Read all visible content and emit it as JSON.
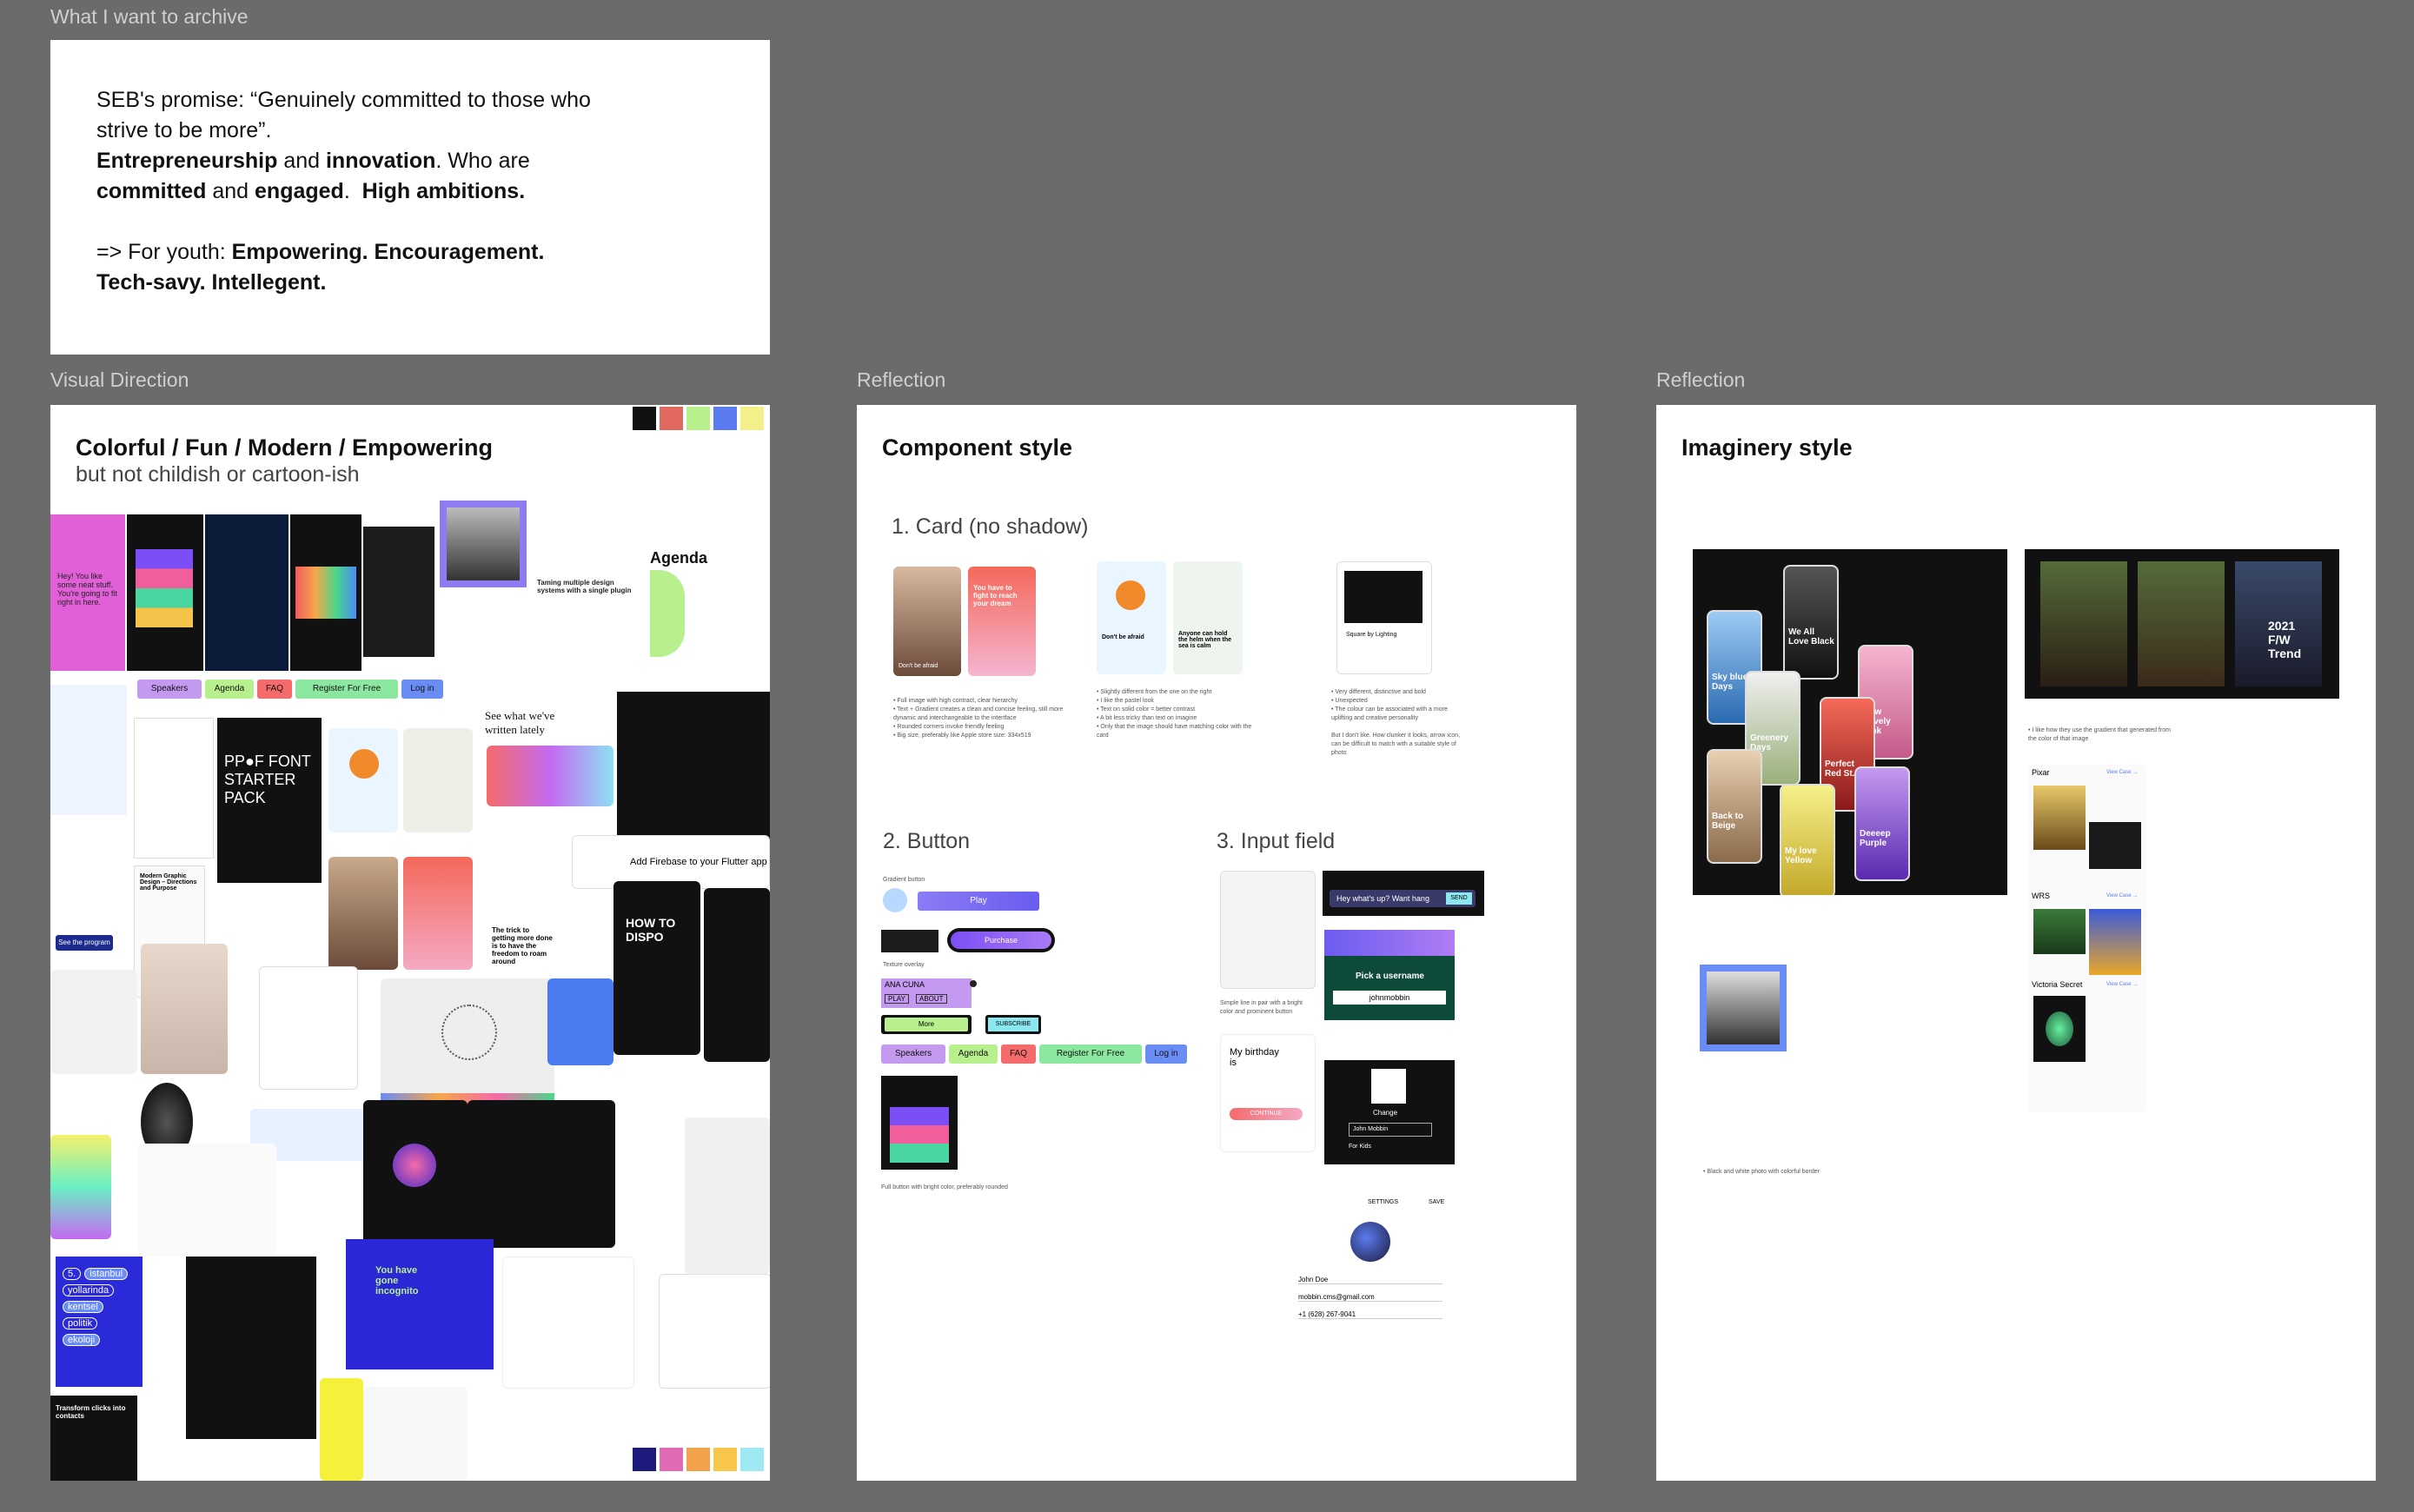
{
  "labels": {
    "archive": "What I want to archive",
    "visual": "Visual Direction",
    "reflection1": "Reflection",
    "reflection2": "Reflection"
  },
  "archive": {
    "line1": "SEB's promise: “Genuinely committed to those who",
    "line2": "strive to be more”.",
    "l3_b1": "Entrepreneurship",
    "l3_t1": " and ",
    "l3_b2": "innovation",
    "l3_t2": ". Who are",
    "l4_b1": "committed",
    "l4_t1": " and ",
    "l4_b2": "engaged",
    "l4_t2": ".  ",
    "l4_b3": "High ambitions.",
    "l5_t1": "=> For youth: ",
    "l5_b1": "Empowering. Encouragement.",
    "l6_b1": "Tech-savy. Intellegent."
  },
  "visual": {
    "title": "Colorful / Fun / Modern / Empowering",
    "subtitle": "but not childish or cartoon-ish",
    "palette_top": [
      "#111111",
      "#e0685f",
      "#b7f08c",
      "#5b7cf0",
      "#f3f08a"
    ],
    "palette_bottom": [
      "#1c1a7a",
      "#e06ab3",
      "#f2a24b",
      "#f7c64a",
      "#9fe9f2"
    ],
    "pills": [
      "Speakers",
      "Agenda",
      "FAQ",
      "Register For Free",
      "Log in"
    ],
    "agenda": "Agenda",
    "pink_text": "Hey! You like some neat stuff. You're going to fit right in here.",
    "font_pack": "PP●F FONT STARTER PACK",
    "see_what": "See what we've written lately",
    "firebase": "Add Firebase to your Flutter app",
    "how_to": "HOW TO DISPO",
    "program_btn": "See the program",
    "istanbul": [
      "5.",
      "istanbul",
      "yollarinda",
      "kentsel",
      "politik",
      "ekoloji"
    ],
    "incognito": "You have gone incognito",
    "trick": "The trick to getting more done is to have the freedom to roam around",
    "taming": "Taming multiple design systems with a single plugin",
    "graphic": "Modern Graphic Design – Directions and Purpose",
    "transform": "Transform clicks into contacts"
  },
  "component": {
    "title": "Component style",
    "card_heading": "1. Card (no shadow)",
    "button_heading": "2. Button",
    "input_heading": "3. Input field",
    "card_notes1": "• Full image with high contract, clear hierarchy\n• Text + Gradient creates a clean and concise feeling, still more dynamic and interchangeable to the intertface\n• Rounded corners invoke friendly feeling\n• Big size, preferably like Apple store size: 334x519",
    "card_notes2": "• Slightly different from the one on the right\n• I like the pastel look\n• Text on solid color = better contrast\n• A bit less tricky than text on imagine\n• Only that the image should have matching color with the card",
    "card_notes3": "• Very different, distinctive and bold\n• Unexpected\n• The colour can be associated with a more uplifting and creative personality\n\nBut I don't like. How clunker it looks, arrow icon, can be difficult to match with a suitable style of photo",
    "card_texts": [
      "Don't be afraid",
      "You have to fight to reach your dream",
      "Don't be afraid",
      "Anyone can hold the helm when the sea is calm",
      "Square by Lighting"
    ],
    "gradient_label": "Gradient button",
    "texture_label": "Texture overlay",
    "play": "Play",
    "purchase": "Purchase",
    "ana_cuna": "ANA CUNA",
    "play2": "PLAY",
    "about": "ABOUT",
    "subscribe": "SUBSCRIBE",
    "more": "More",
    "pills": [
      "Speakers",
      "Agenda",
      "FAQ",
      "Register For Free",
      "Log in"
    ],
    "full_btn_note": "Full button with bright color, preferably rounded",
    "search_placeholder": "Hey what's up? Want hang",
    "send": "SEND",
    "pick_username": "Pick a username",
    "username": "johnmobbin",
    "change": "Change",
    "name_field": "John Mobbin",
    "for_kids": "For Kids",
    "birthday": "My birthday is",
    "continue": "CONTINUE",
    "simple_note": "Simple line in pair with a bright color and prominent button",
    "settings": "SETTINGS",
    "save": "SAVE",
    "john_doe": "John Doe",
    "email": "mobbin.cms@gmail.com",
    "phone": "+1 (628) 267-9041"
  },
  "imagery": {
    "title": "Imaginery style",
    "phones": [
      "Sky blue Days",
      "We All Love Black",
      "How Lovely Pink",
      "Greenery Days",
      "Perfect Red St.",
      "Back to Beige",
      "My love Yellow",
      "Deeeep Purple"
    ],
    "trend": "2021 F/W Trend",
    "note1": "• I like how they use the gradient that generated from the color of that image",
    "pixar": "Pixar",
    "wrs": "WRS",
    "victoria": "Victoria Secret",
    "view_case": "View Case →",
    "bw_note": "• Black and white photo with colorful border"
  }
}
